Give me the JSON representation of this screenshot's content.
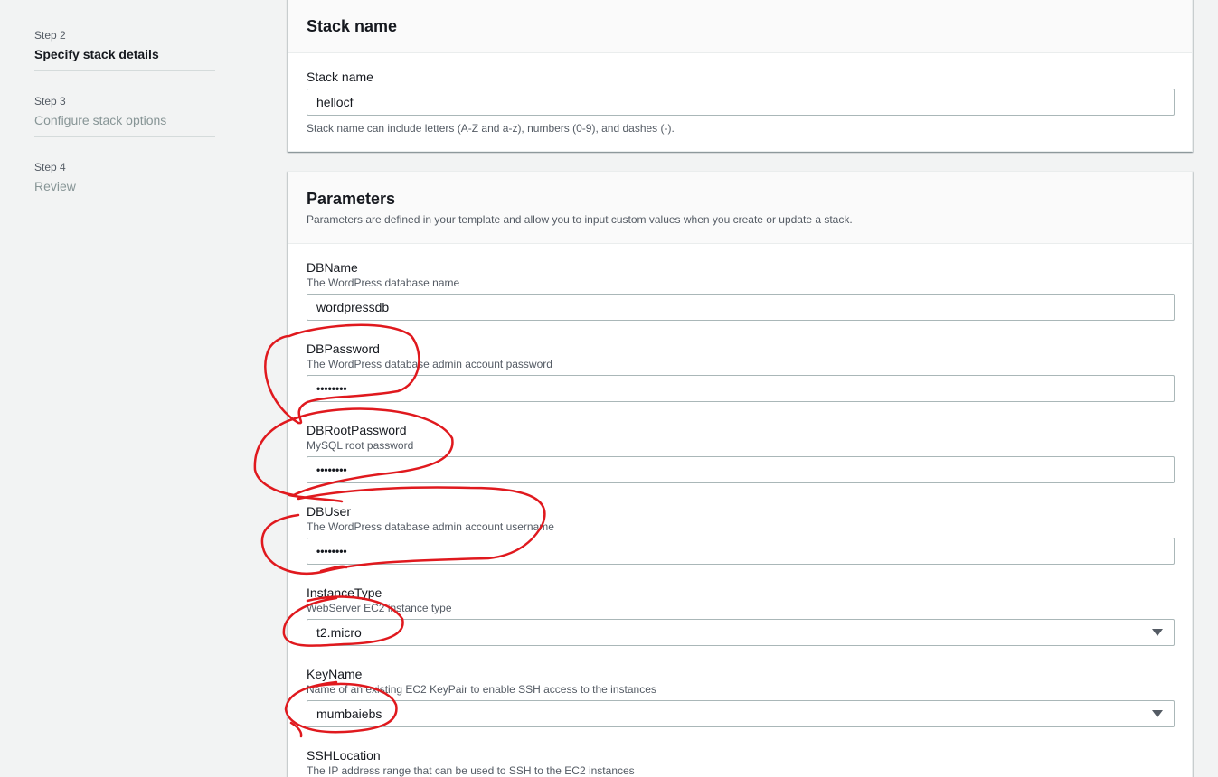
{
  "nav": {
    "steps": [
      {
        "num": "Step 2",
        "title": "Specify stack details",
        "state": "active"
      },
      {
        "num": "Step 3",
        "title": "Configure stack options",
        "state": "inactive"
      },
      {
        "num": "Step 4",
        "title": "Review",
        "state": "inactive"
      }
    ]
  },
  "stack_panel": {
    "title": "Stack name",
    "field_label": "Stack name",
    "value": "hellocf",
    "hint": "Stack name can include letters (A-Z and a-z), numbers (0-9), and dashes (-)."
  },
  "params_panel": {
    "title": "Parameters",
    "description": "Parameters are defined in your template and allow you to input custom values when you create or update a stack.",
    "fields": [
      {
        "label": "DBName",
        "desc": "The WordPress database name",
        "value": "wordpressdb"
      },
      {
        "label": "DBPassword",
        "desc": "The WordPress database admin account password",
        "value": "••••••••"
      },
      {
        "label": "DBRootPassword",
        "desc": "MySQL root password",
        "value": "••••••••"
      },
      {
        "label": "DBUser",
        "desc": "The WordPress database admin account username",
        "value": "••••••••"
      },
      {
        "label": "InstanceType",
        "desc": "WebServer EC2 instance type",
        "value": "t2.micro"
      },
      {
        "label": "KeyName",
        "desc": "Name of an existing EC2 KeyPair to enable SSH access to the instances",
        "value": "mumbaiebs"
      },
      {
        "label": "SSHLocation",
        "desc": "The IP address range that can be used to SSH to the EC2 instances",
        "value": ""
      }
    ]
  },
  "colors": {
    "annotation": "#e0191e",
    "page_bg": "#f2f3f3",
    "panel_header_bg": "#fafafa"
  }
}
